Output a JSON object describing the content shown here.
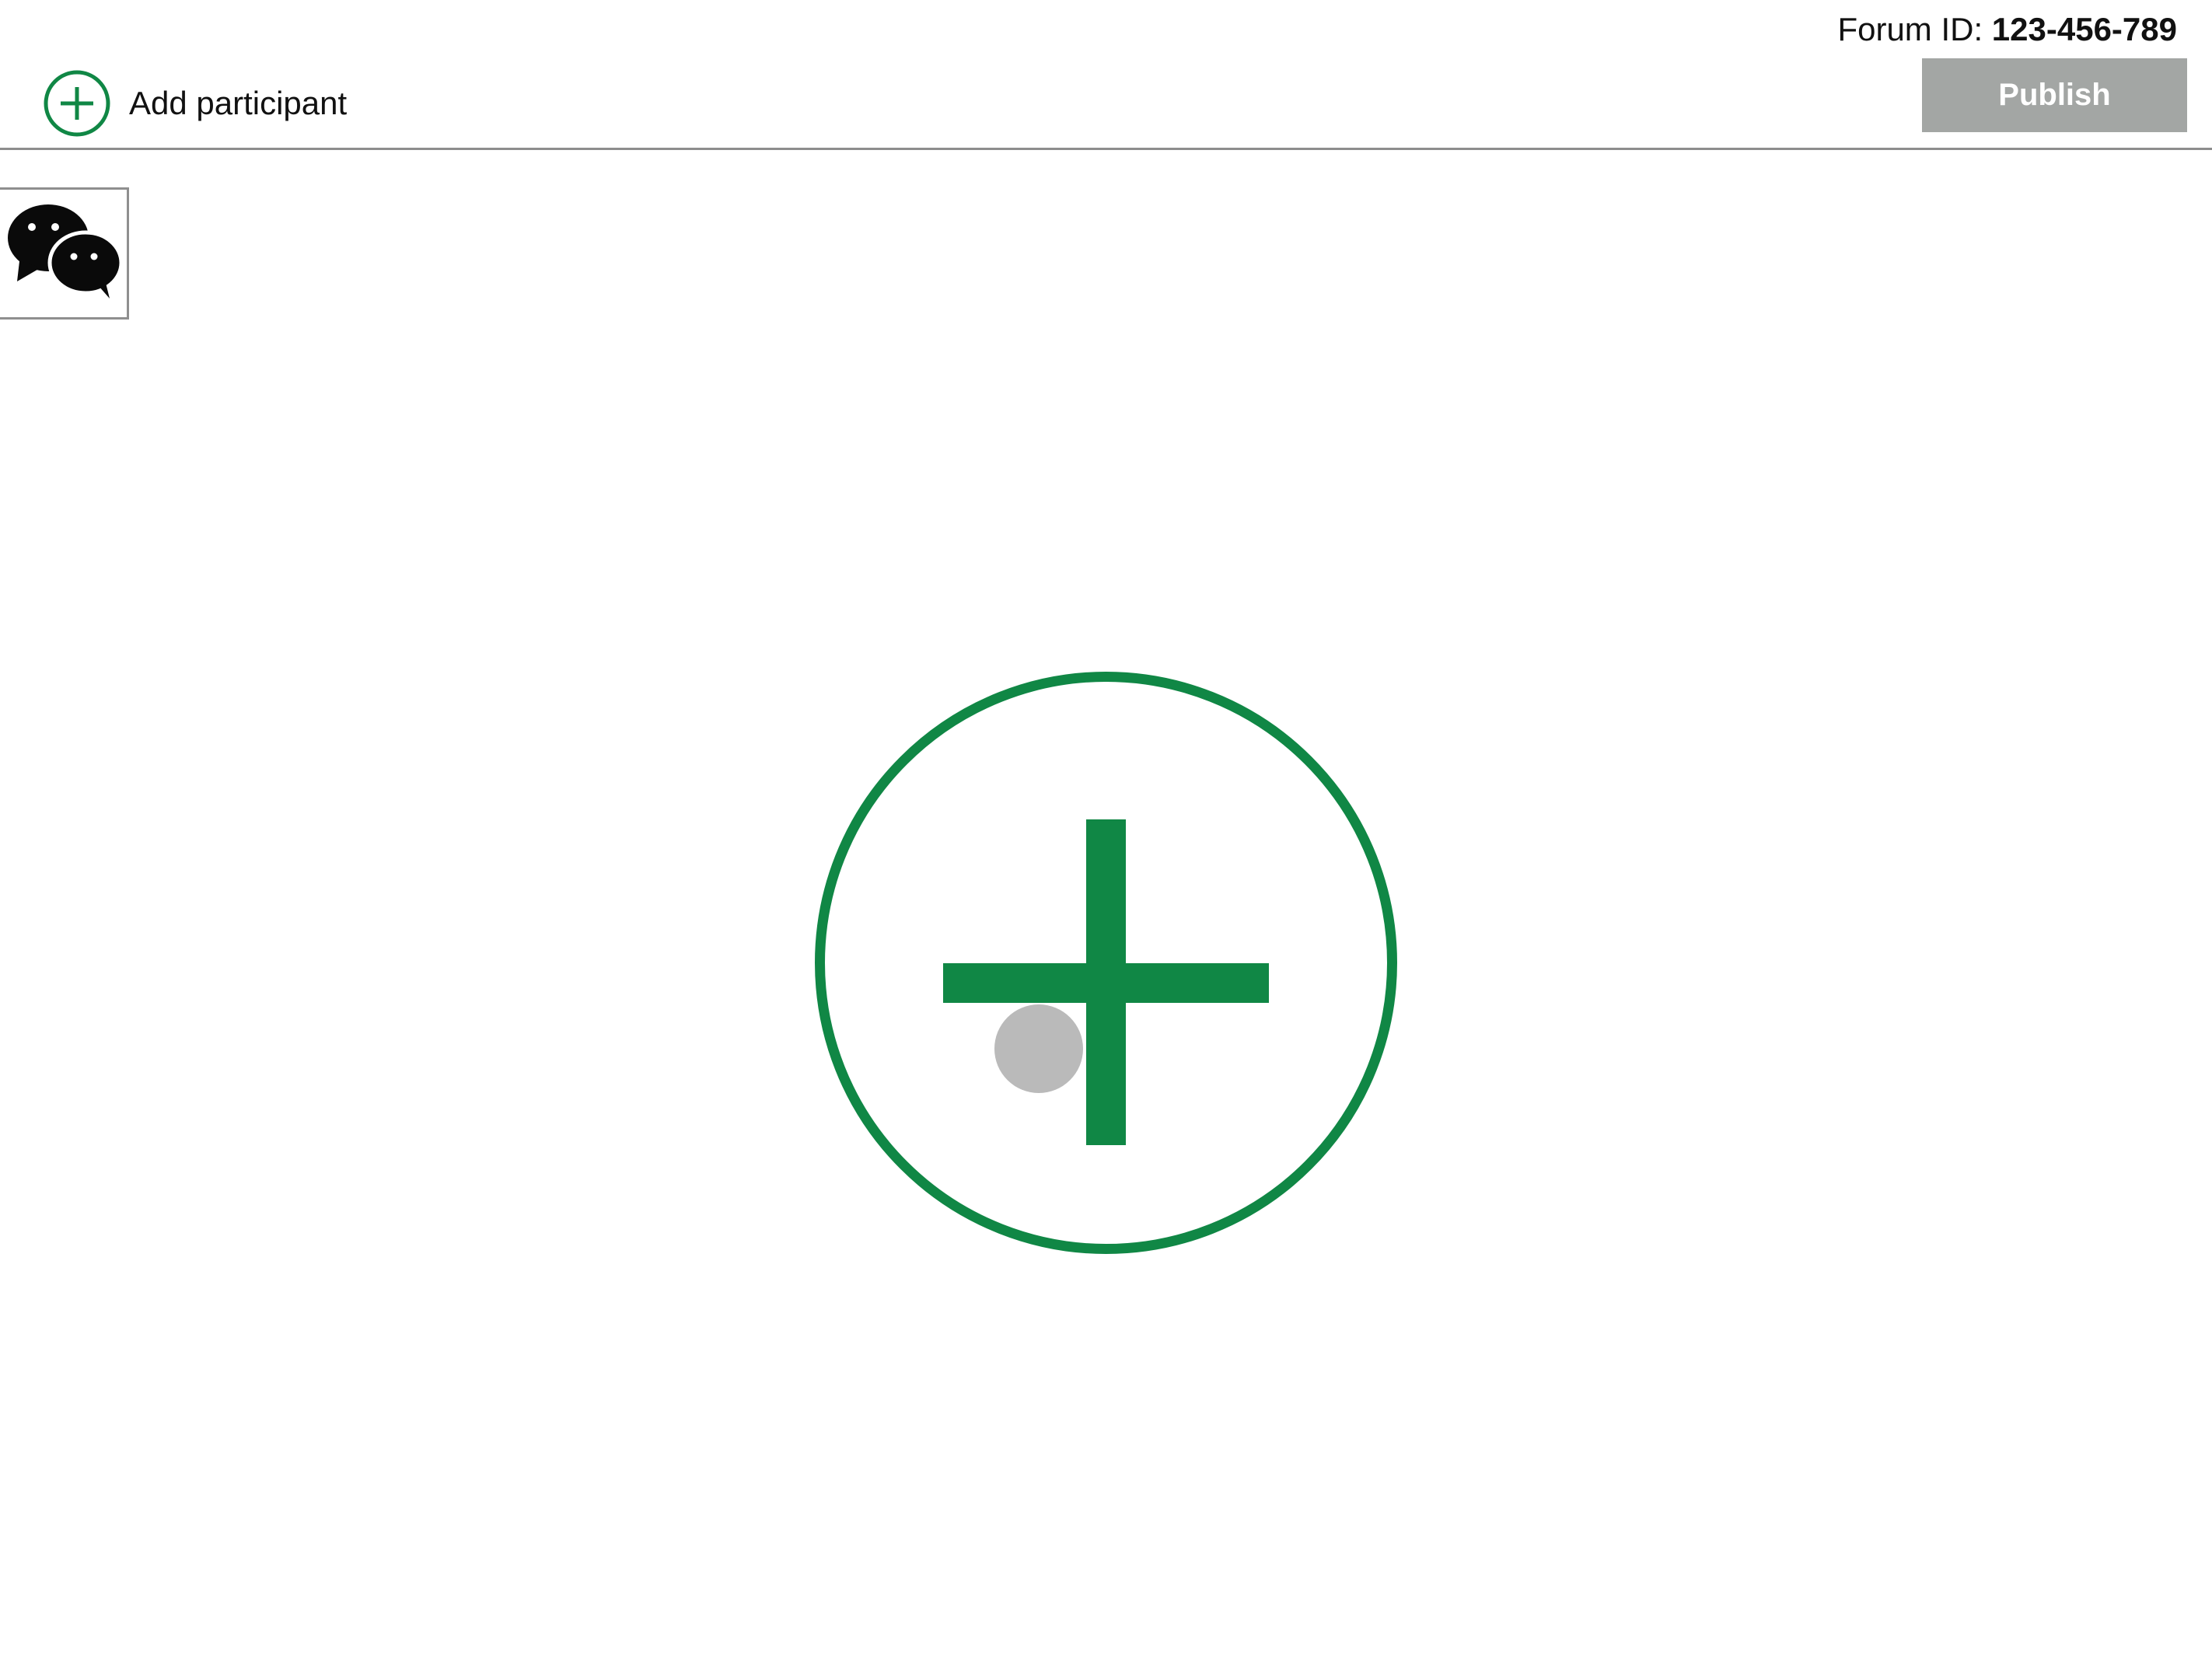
{
  "header": {
    "forum_id_label": "Forum ID:",
    "forum_id_value": "123-456-789",
    "publish_label": "Publish",
    "add_participant_label": "Add participant"
  },
  "icons": {
    "add_participant": "plus-circle-icon",
    "chat_tile": "chat-bubbles-icon",
    "center_action": "plus-circle-icon"
  },
  "colors": {
    "accent_green": "#108745",
    "publish_disabled_bg": "#a3a6a4",
    "divider": "#8d8d8d",
    "touch_indicator": "#bababa"
  }
}
